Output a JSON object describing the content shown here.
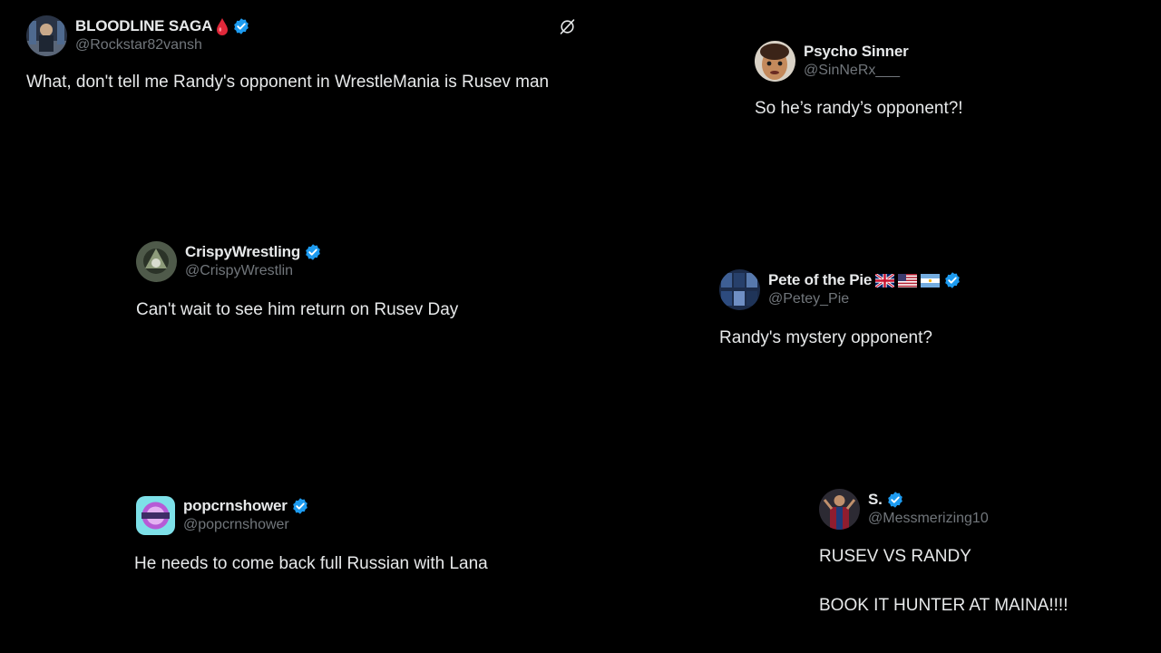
{
  "colors": {
    "background": "#000000",
    "text": "#e7e9ea",
    "handle": "#71767b",
    "verified": "#1d9bf0"
  },
  "tweets": [
    {
      "display_name": "BLOODLINE SAGA",
      "emoji": "drop-of-blood-icon",
      "verified": true,
      "handle": "@Rockstar82vansh",
      "text": "What, don't tell me Randy's opponent in WrestleMania is Rusev man"
    },
    {
      "display_name": "Psycho Sinner",
      "verified": false,
      "handle": "@SinNeRx___",
      "text": "So he’s randy’s opponent?!"
    },
    {
      "display_name": "CrispyWrestling",
      "verified": true,
      "handle": "@CrispyWrestlin",
      "text": "Can't wait to see him return on Rusev Day"
    },
    {
      "display_name": "Pete of the Pie",
      "flags": [
        "uk-flag-icon",
        "us-flag-icon",
        "argentina-flag-icon"
      ],
      "verified": true,
      "handle": "@Petey_Pie",
      "text": "Randy's mystery opponent?"
    },
    {
      "display_name": "popcrnshower",
      "verified": true,
      "handle": "@popcrnshower",
      "text": "He needs to come back full Russian with Lana"
    },
    {
      "display_name": "S.",
      "verified": true,
      "handle": "@Messmerizing10",
      "text_line1": "RUSEV VS RANDY",
      "text_line2": "BOOK IT HUNTER AT MAINA!!!!"
    }
  ],
  "icons": {
    "logo": "x-logo-icon"
  }
}
